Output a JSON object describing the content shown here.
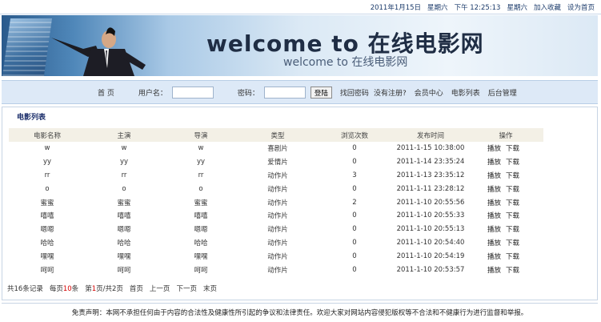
{
  "topbar": {
    "date": "2011年1月15日",
    "weekday": "星期六",
    "time": "下午 12:25:13",
    "weekday2": "星期六",
    "bookmark": "加入收藏",
    "homepage": "设为首页"
  },
  "banner": {
    "title": "welcome to 在线电影网",
    "subtitle": "welcome to 在线电影网"
  },
  "nav": {
    "home": "首 页",
    "username_label": "用户名：",
    "username_value": "",
    "password_label": "密码：",
    "password_value": "",
    "login_button": "登陆",
    "forgot": "找回密码",
    "register": "没有注册?",
    "member": "会员中心",
    "movies": "电影列表",
    "admin": "后台管理"
  },
  "list": {
    "heading": "电影列表",
    "columns": [
      "电影名称",
      "主演",
      "导演",
      "类型",
      "浏览次数",
      "发布时间",
      "操作"
    ],
    "play_label": "播放",
    "download_label": "下载",
    "rows": [
      [
        "w",
        "w",
        "w",
        "喜剧片",
        "0",
        "2011-1-15 10:38:00"
      ],
      [
        "yy",
        "yy",
        "yy",
        "爱情片",
        "0",
        "2011-1-14 23:35:24"
      ],
      [
        "rr",
        "rr",
        "rr",
        "动作片",
        "3",
        "2011-1-13 23:35:12"
      ],
      [
        "o",
        "o",
        "o",
        "动作片",
        "0",
        "2011-1-11 23:28:12"
      ],
      [
        "蜜蜜",
        "蜜蜜",
        "蜜蜜",
        "动作片",
        "2",
        "2011-1-10 20:55:56"
      ],
      [
        "嘻嘻",
        "嘻嘻",
        "嘻嘻",
        "动作片",
        "0",
        "2011-1-10 20:55:33"
      ],
      [
        "嗯嗯",
        "嗯嗯",
        "嗯嗯",
        "动作片",
        "0",
        "2011-1-10 20:55:13"
      ],
      [
        "哈哈",
        "哈哈",
        "哈哈",
        "动作片",
        "0",
        "2011-1-10 20:54:40"
      ],
      [
        "嘿嘿",
        "嘿嘿",
        "嘿嘿",
        "动作片",
        "0",
        "2011-1-10 20:54:19"
      ],
      [
        "呵呵",
        "呵呵",
        "呵呵",
        "动作片",
        "0",
        "2011-1-10 20:53:57"
      ]
    ]
  },
  "pager": {
    "total": "共16条记录",
    "per_page_prefix": "每页",
    "per_page_num": "10",
    "per_page_suffix": "条",
    "page_prefix": "第",
    "page_num": "1",
    "page_suffix": "页/共2页",
    "first": "首页",
    "prev": "上一页",
    "next": "下一页",
    "last": "末页"
  },
  "footer": {
    "text": "免责声明：本网不承担任何由于内容的合法性及健康性所引起的争议和法律责任。欢迎大家对网站内容侵犯版权等不合法和不健康行为进行监督和举报。"
  },
  "colors": {
    "nav_bg": "#dde9f7",
    "header_bg": "#f3f0e6",
    "pager_red": "#d40000",
    "heading": "#1c2f6b"
  }
}
